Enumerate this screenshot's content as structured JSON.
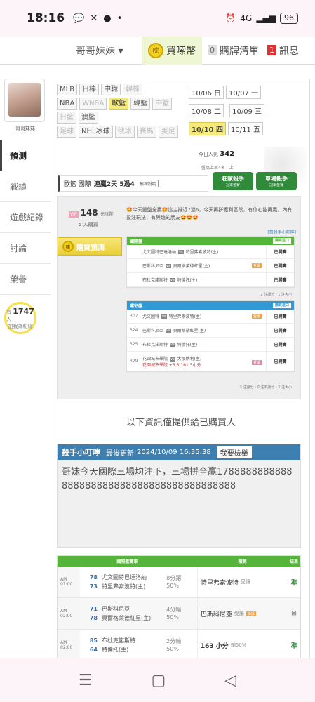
{
  "status_bar": {
    "time": "18:16",
    "battery": "96",
    "network": "4G"
  },
  "top_nav": {
    "user": "哥哥妹妹 ▾",
    "buy_coin": "買嗦幣",
    "cart_count": "0",
    "cart": "購牌清單",
    "msg_count": "1",
    "msg": "訊息"
  },
  "sidebar": {
    "name": "哥哥妹妹",
    "items": [
      "預測",
      "戰績",
      "遊戲紀錄",
      "討論",
      "榮譽"
    ],
    "fans_count": "1747",
    "fans_prefix": "有",
    "fans_suffix": "人",
    "fans_label": "加我為粉絲"
  },
  "sports": {
    "row1": [
      "MLB",
      "日棒",
      "中職",
      "韓棒"
    ],
    "row2": [
      "NBA",
      "WNBA",
      "歐籃",
      "韓籃",
      "中籃"
    ],
    "row3": [
      "日籃",
      "澳籃"
    ],
    "row4": [
      "足球",
      "NHL冰球",
      "俄冰",
      "賽馬",
      "美足"
    ]
  },
  "dates": [
    "10/06 日",
    "10/07 一",
    "10/08 二",
    "10/09 三",
    "10/10 四",
    "10/11 五"
  ],
  "popularity": {
    "label": "今日人氣",
    "value": "342",
    "rank": "盤品上第4名 | 上"
  },
  "header": {
    "league": "歐籃 國際",
    "streak": "連贏2天 5過4",
    "tag": "預測說明"
  },
  "badges": {
    "left": "莊家殺手",
    "left_sub": "冠軍金賽",
    "right": "單場殺手",
    "right_sub": "冠軍金賽"
  },
  "card": {
    "vip": "VIP",
    "price": "148",
    "price_unit": "元嗦幣",
    "buyers": "5 人購買",
    "desc": "🤩今天雙盤全贏🤩這主推近7過6，今天再拼獲利區段，有信心能再贏，內有投注玩法，有興趣的朋友🤩🤩🤩",
    "buy_btn": "購買預測",
    "tip_link": "[哥殺手小叮嚀]",
    "intl_title": "國際盤",
    "intl_action": "購買這口",
    "intl_rows": [
      {
        "home": "尤文圖特巴達洛納",
        "away": "特里弗索波特(主)",
        "status": "已開賽",
        "tag": ""
      },
      {
        "home": "巴斯科尼亞",
        "away": "貝爾格萊德紅星(主)",
        "status": "已開賽",
        "tag": "受讓"
      },
      {
        "home": "布杜克諾斯特",
        "away": "特倫托(主)",
        "status": "已開賽",
        "tag": ""
      }
    ],
    "intl_foot": "2 注讓分・1 注大小",
    "tw_title": "運彩盤",
    "tw_action": "購買這口",
    "tw_rows": [
      {
        "no": "307",
        "home": "尤文圖特",
        "away": "特里弗索波特(主)",
        "status": "已開賽",
        "tag": "受讓"
      },
      {
        "no": "324",
        "home": "巴斯科尼亞",
        "away": "貝爾格勒紅星(主)",
        "status": "已開賽",
        "tag": ""
      },
      {
        "no": "325",
        "home": "布杜克諾斯特",
        "away": "特倫托(主)",
        "status": "已開賽",
        "tag": ""
      },
      {
        "no": "329",
        "home": "花園城市學院",
        "away": "大阪納利(主)",
        "status": "已開賽",
        "tag": "受讓",
        "extra": "花園城市學院 +5.5 161.5小分"
      }
    ],
    "tw_foot": "3 注讓分・0 注不讓分・2 注大小"
  },
  "notice": "以下資訊僅提供給已購買人",
  "tips": {
    "title": "殺手小叮嚀",
    "updated_label": "最後更新",
    "updated": "2024/10/09 16:35:38",
    "btn": "我要檢舉",
    "body": "哥妹今天國際三場均注下，三場拼全贏1788888888888888888888888888888888888888888"
  },
  "schedule": {
    "headers": [
      "國際盤賽事",
      "預測",
      "結果"
    ],
    "rows": [
      {
        "time": "AM 01:00",
        "no1": "78",
        "team1": "尤文圖特巴達洛納",
        "no2": "73",
        "team2": "特里弗索波特(主)",
        "line": "8分讓",
        "line2": "50%",
        "pick": "特里弗索波特",
        "pick_sub": "受讓",
        "tag": "",
        "result": "準"
      },
      {
        "time": "AM 02:00",
        "no1": "71",
        "team1": "巴斯科尼亞",
        "no2": "78",
        "team2": "貝爾格萊德紅星(主)",
        "line": "4分輸",
        "line2": "50%",
        "pick": "巴斯科尼亞",
        "pick_sub": "受讓",
        "tag": "受讓",
        "result": "⊠"
      },
      {
        "time": "AM 02:00",
        "no1": "85",
        "team1": "布杜克諾斯特",
        "no2": "64",
        "team2": "特倫托(主)",
        "line": "2分輸",
        "line2": "50%",
        "pick": "163 小分",
        "pick_sub": "輸50%",
        "tag": "",
        "result": "準"
      }
    ]
  },
  "nav_bar": {
    "menu": "☰",
    "home": "▢",
    "back": "◁"
  },
  "colors": {
    "accent_green": "#55b53a",
    "accent_blue": "#3d7fb0",
    "highlight": "#f6eb7a"
  }
}
